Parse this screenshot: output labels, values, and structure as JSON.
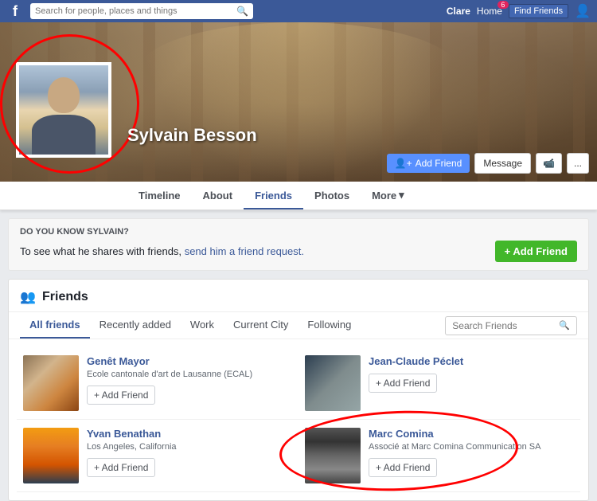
{
  "topNav": {
    "logoText": "f",
    "searchPlaceholder": "Search for people, places and things",
    "userName": "Clare",
    "homeLabel": "Home",
    "homeBadge": "6",
    "findFriendsLabel": "Find Friends"
  },
  "cover": {
    "profileName": "Sylvain Besson",
    "addFriendLabel": "Add Friend",
    "messageLabel": "Message",
    "moreLabel": "..."
  },
  "tabs": [
    {
      "label": "Timeline",
      "active": false
    },
    {
      "label": "About",
      "active": false
    },
    {
      "label": "Friends",
      "active": true
    },
    {
      "label": "Photos",
      "active": false
    },
    {
      "label": "More",
      "active": false
    }
  ],
  "knowBanner": {
    "title": "DO YOU KNOW SYLVAIN?",
    "desc": "To see what he shares with friends,",
    "linkText": "send him a friend request.",
    "addFriendLabel": "+ Add Friend"
  },
  "friends": {
    "sectionTitle": "Friends",
    "filterTabs": [
      {
        "label": "All friends",
        "active": true
      },
      {
        "label": "Recently added",
        "active": false
      },
      {
        "label": "Work",
        "active": false
      },
      {
        "label": "Current City",
        "active": false
      },
      {
        "label": "Following",
        "active": false
      }
    ],
    "searchPlaceholder": "Search Friends",
    "cards": [
      {
        "name": "Genêt Mayor",
        "sub": "Ecole cantonale d'art de Lausanne (ECAL)",
        "addLabel": "+ Add Friend",
        "avatarClass": "avatar-genet"
      },
      {
        "name": "Jean-Claude Péclet",
        "sub": "",
        "addLabel": "+ Add Friend",
        "avatarClass": "avatar-jean"
      },
      {
        "name": "Yvan Benathan",
        "sub": "Los Angeles, California",
        "addLabel": "+ Add Friend",
        "avatarClass": "avatar-yvan"
      },
      {
        "name": "Marc Comina",
        "sub": "Associé at Marc Comina Communication SA",
        "addLabel": "+ Add Friend",
        "avatarClass": "avatar-marc"
      }
    ]
  }
}
